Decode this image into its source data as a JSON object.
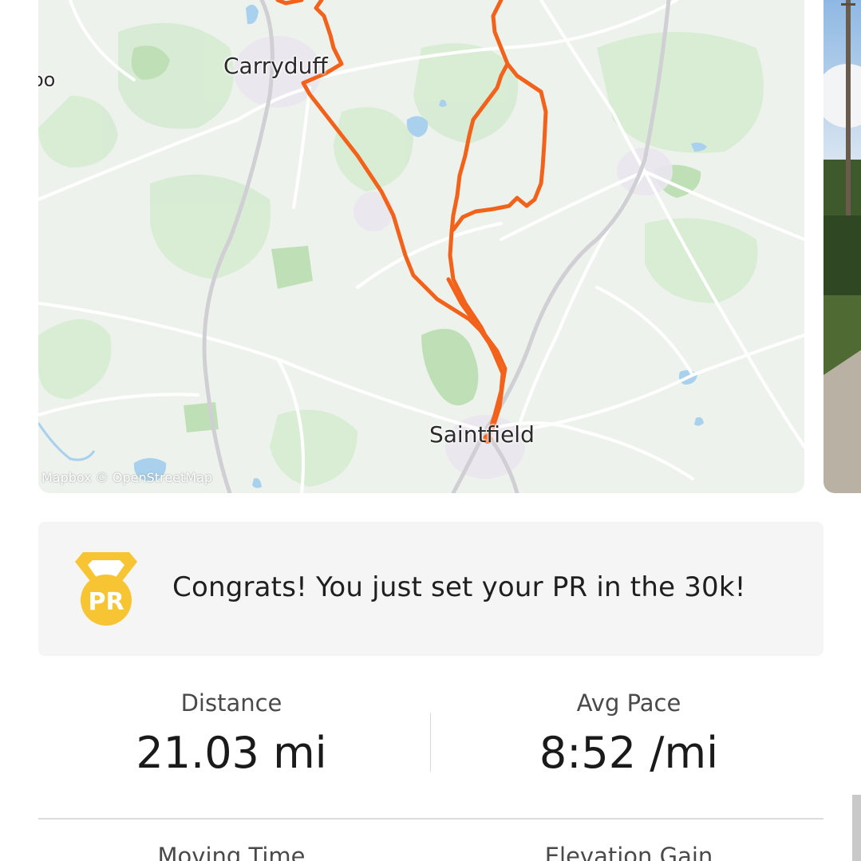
{
  "map": {
    "labels": {
      "carryduff": "Carryduff",
      "saintfield": "Saintfield",
      "partial_left": "oo"
    },
    "attribution": "Mapbox © OpenStreetMap",
    "route_color": "#f2621b"
  },
  "pr_banner": {
    "icon": "pr-medal-icon",
    "medal_text": "PR",
    "message": "Congrats! You just set your PR in the 30k!",
    "medal_color": "#f7c533"
  },
  "stats": {
    "distance": {
      "label": "Distance",
      "value": "21.03 mi"
    },
    "avg_pace": {
      "label": "Avg Pace",
      "value": "8:52 /mi"
    },
    "moving_time": {
      "label": "Moving Time"
    },
    "elevation_gain": {
      "label": "Elevation Gain"
    }
  }
}
